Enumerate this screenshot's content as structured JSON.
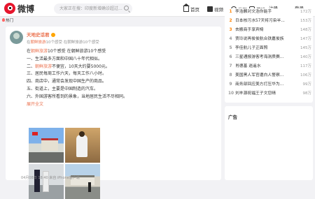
{
  "header": {
    "logo_text": "微博",
    "search_placeholder": "大家正在搜：印度新增确诊超过...",
    "nav": [
      {
        "label": "首页",
        "icon": "home-icon"
      },
      {
        "label": "视频",
        "icon": "video-icon"
      },
      {
        "label": "发现",
        "icon": "compass-icon"
      },
      {
        "label": "游戏",
        "icon": "game-icon"
      }
    ],
    "register": "注册",
    "login": "登录"
  },
  "hot_label": "热门",
  "post": {
    "author": "天地史话君",
    "meta_prefix": "在",
    "meta_link": "朝鲜旅游",
    "meta_suffix": "10个感受 在朝鲜旅游10个感受",
    "lines": [
      {
        "prefix": "在",
        "link": "朝鲜旅游",
        "text": "10个感受 在朝鲜旅游10个感受"
      },
      {
        "prefix": "",
        "link": "",
        "text": "一、生活最多方面和中国八十年代相似。"
      },
      {
        "prefix": "二、",
        "link": "朝鲜旅游",
        "text": "不便宜，10天大约要5000元。"
      },
      {
        "prefix": "",
        "link": "",
        "text": "三、居民每周工作六天，每天工作八小时。"
      },
      {
        "prefix": "",
        "link": "",
        "text": "四、商店中，通常会发现中国生产的商品。"
      },
      {
        "prefix": "",
        "link": "",
        "text": "五、街道上，主要是中国制造的汽车。"
      },
      {
        "prefix": "",
        "link": "",
        "text": "六、外国游客所看到的景象，当地居民生活不尽相同。"
      }
    ],
    "expand": "展开全文",
    "footer": "04月08日 18:40 来自 iPhone客户端"
  },
  "ranking": [
    {
      "num": "1",
      "title": "李浩麟对文浩你能手",
      "count": "172万"
    },
    {
      "num": "2",
      "title": "日本核污水57天将污染半...",
      "count": "153万"
    },
    {
      "num": "3",
      "title": "去搬商手享宾椅",
      "count": "148万"
    },
    {
      "num": "4",
      "title": "贾玲说再俊俊航合铁嘉俊族",
      "count": "147万"
    },
    {
      "num": "5",
      "title": "李佳航儿子正面照",
      "count": "145万"
    },
    {
      "num": "6",
      "title": "三星通报游客考海测质赛...",
      "count": "140万"
    },
    {
      "num": "7",
      "title": "肖德基 逍遥水",
      "count": "117万"
    },
    {
      "num": "8",
      "title": "美国黑人军官遭白人警察...",
      "count": "106万"
    },
    {
      "num": "9",
      "title": "商务部回应美方打压华为...",
      "count": "99万"
    },
    {
      "num": "10",
      "title": "刘丰源祝福王子文您晴",
      "count": "98万"
    }
  ],
  "ad_label": "广告",
  "colors": {
    "brand": "#e6162d",
    "link": "#eb7350",
    "rank_top": "#ff8200"
  }
}
